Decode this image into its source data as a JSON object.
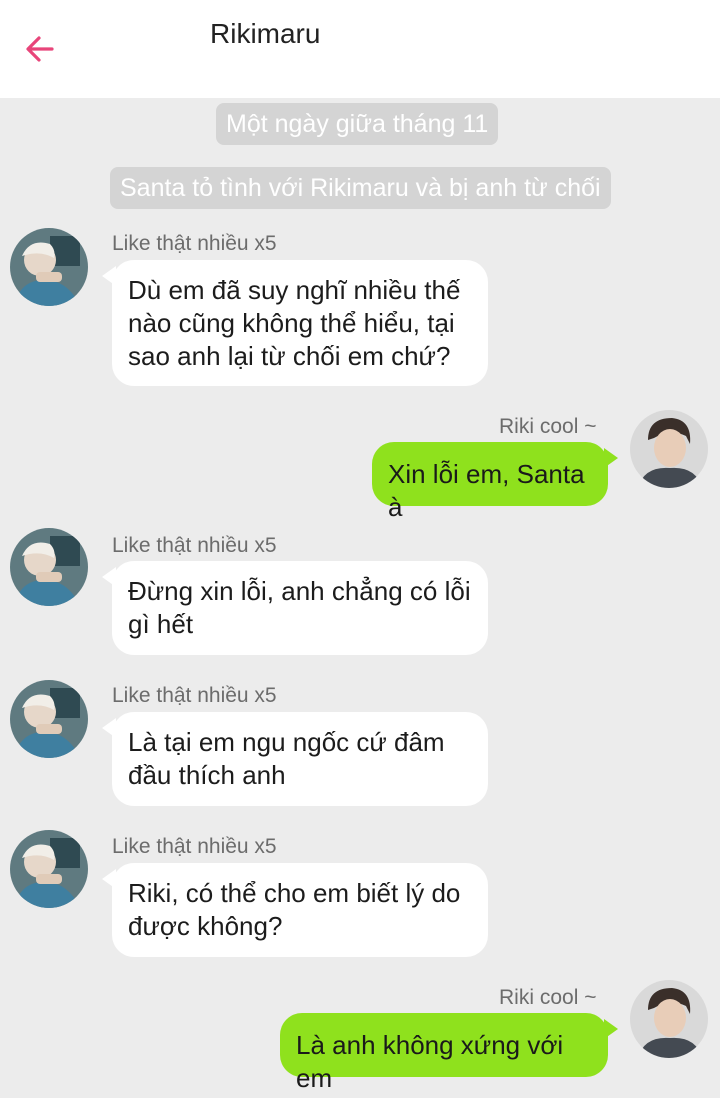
{
  "header": {
    "title": "Rikimaru",
    "back_icon": "arrow-left-icon",
    "accent_color": "#e8457a"
  },
  "system_messages": [
    "Một ngày giữa tháng 11",
    "Santa tỏ tình với Rikimaru và bị anh từ chối"
  ],
  "messages": [
    {
      "side": "left",
      "sender": "Like thật nhiều x5",
      "text": [
        "Dù em đã suy nghĩ nhiều thế",
        "nào cũng không thể hiểu, tại",
        "sao anh lại từ chối em chứ?"
      ]
    },
    {
      "side": "right",
      "sender": "Riki cool ~",
      "text": [
        "Xin lỗi em, Santa à"
      ]
    },
    {
      "side": "left",
      "sender": "Like thật nhiều x5",
      "text": [
        "Đừng xin lỗi, anh chẳng có lỗi",
        "gì hết"
      ]
    },
    {
      "side": "left",
      "sender": "Like thật nhiều x5",
      "text": [
        "Là tại em ngu ngốc cứ đâm",
        "đầu thích anh"
      ]
    },
    {
      "side": "left",
      "sender": "Like thật nhiều x5",
      "text": [
        "Riki, có thể cho em biết lý do",
        "được không?"
      ]
    },
    {
      "side": "right",
      "sender": "Riki cool ~",
      "text": [
        "Là anh không xứng với em"
      ]
    }
  ],
  "colors": {
    "background": "#ececec",
    "outgoing_bubble": "#8fe11d",
    "incoming_bubble": "#ffffff",
    "system_tag": "#d4d4d4"
  }
}
